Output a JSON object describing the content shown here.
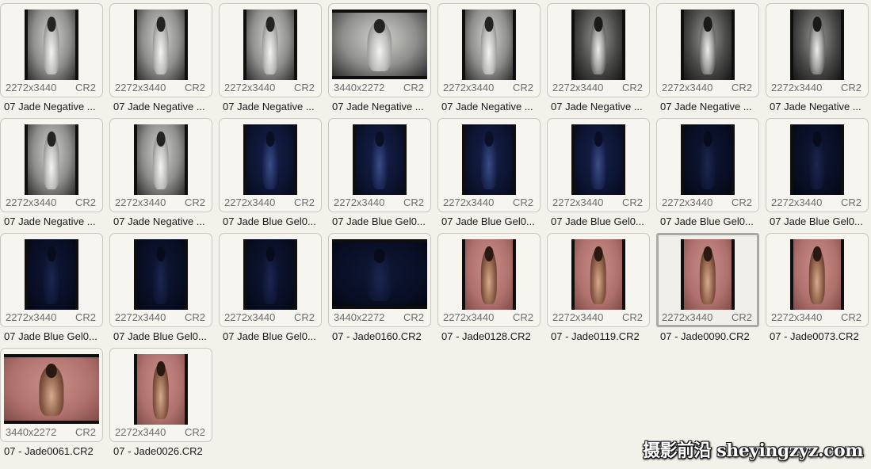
{
  "window": {
    "background": "#f2f1ea",
    "selected_index": 22
  },
  "files": [
    {
      "dims": "2272x3440",
      "ext": "CR2",
      "name": "07 Jade Negative ...",
      "orientation": "portrait",
      "theme": "mono"
    },
    {
      "dims": "2272x3440",
      "ext": "CR2",
      "name": "07 Jade Negative ...",
      "orientation": "portrait",
      "theme": "mono"
    },
    {
      "dims": "2272x3440",
      "ext": "CR2",
      "name": "07 Jade Negative ...",
      "orientation": "portrait",
      "theme": "mono"
    },
    {
      "dims": "3440x2272",
      "ext": "CR2",
      "name": "07 Jade Negative ...",
      "orientation": "landscape",
      "theme": "mono"
    },
    {
      "dims": "2272x3440",
      "ext": "CR2",
      "name": "07 Jade Negative ...",
      "orientation": "portrait",
      "theme": "mono"
    },
    {
      "dims": "2272x3440",
      "ext": "CR2",
      "name": "07 Jade Negative ...",
      "orientation": "portrait",
      "theme": "monodark"
    },
    {
      "dims": "2272x3440",
      "ext": "CR2",
      "name": "07 Jade Negative ...",
      "orientation": "portrait",
      "theme": "monodark"
    },
    {
      "dims": "2272x3440",
      "ext": "CR2",
      "name": "07 Jade Negative ...",
      "orientation": "portrait",
      "theme": "monodark"
    },
    {
      "dims": "2272x3440",
      "ext": "CR2",
      "name": "07 Jade Negative ...",
      "orientation": "portrait",
      "theme": "mono"
    },
    {
      "dims": "2272x3440",
      "ext": "CR2",
      "name": "07 Jade Negative ...",
      "orientation": "portrait",
      "theme": "mono"
    },
    {
      "dims": "2272x3440",
      "ext": "CR2",
      "name": "07 Jade Blue Gel0...",
      "orientation": "portrait",
      "theme": "blue"
    },
    {
      "dims": "2272x3440",
      "ext": "CR2",
      "name": "07 Jade Blue Gel0...",
      "orientation": "portrait",
      "theme": "blue"
    },
    {
      "dims": "2272x3440",
      "ext": "CR2",
      "name": "07 Jade Blue Gel0...",
      "orientation": "portrait",
      "theme": "blue"
    },
    {
      "dims": "2272x3440",
      "ext": "CR2",
      "name": "07 Jade Blue Gel0...",
      "orientation": "portrait",
      "theme": "blue"
    },
    {
      "dims": "2272x3440",
      "ext": "CR2",
      "name": "07 Jade Blue Gel0...",
      "orientation": "portrait",
      "theme": "bluedark"
    },
    {
      "dims": "2272x3440",
      "ext": "CR2",
      "name": "07 Jade Blue Gel0...",
      "orientation": "portrait",
      "theme": "bluedark"
    },
    {
      "dims": "2272x3440",
      "ext": "CR2",
      "name": "07 Jade Blue Gel0...",
      "orientation": "portrait",
      "theme": "bluedark"
    },
    {
      "dims": "2272x3440",
      "ext": "CR2",
      "name": "07 Jade Blue Gel0...",
      "orientation": "portrait",
      "theme": "bluedark"
    },
    {
      "dims": "2272x3440",
      "ext": "CR2",
      "name": "07 Jade Blue Gel0...",
      "orientation": "portrait",
      "theme": "bluedark"
    },
    {
      "dims": "3440x2272",
      "ext": "CR2",
      "name": "07 - Jade0160.CR2",
      "orientation": "landscape",
      "theme": "bluedark"
    },
    {
      "dims": "2272x3440",
      "ext": "CR2",
      "name": "07 - Jade0128.CR2",
      "orientation": "portrait",
      "theme": "pink"
    },
    {
      "dims": "2272x3440",
      "ext": "CR2",
      "name": "07 - Jade0119.CR2",
      "orientation": "portrait",
      "theme": "pink"
    },
    {
      "dims": "2272x3440",
      "ext": "CR2",
      "name": "07 - Jade0090.CR2",
      "orientation": "portrait",
      "theme": "pink"
    },
    {
      "dims": "2272x3440",
      "ext": "CR2",
      "name": "07 - Jade0073.CR2",
      "orientation": "portrait",
      "theme": "pink"
    },
    {
      "dims": "3440x2272",
      "ext": "CR2",
      "name": "07 - Jade0061.CR2",
      "orientation": "landscape",
      "theme": "pink"
    },
    {
      "dims": "2272x3440",
      "ext": "CR2",
      "name": "07 - Jade0026.CR2",
      "orientation": "portrait",
      "theme": "pink"
    }
  ],
  "watermark": {
    "text": "摄影前沿 sheyingzyz.com"
  }
}
